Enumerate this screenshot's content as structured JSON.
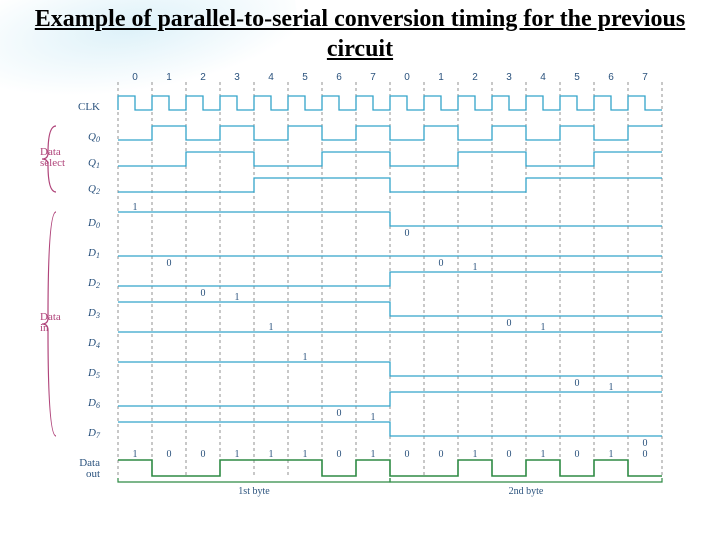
{
  "title": "Example of parallel-to-serial conversion timing for the previous circuit",
  "clk_label": "CLK",
  "ticks": [
    "0",
    "1",
    "2",
    "3",
    "4",
    "5",
    "6",
    "7",
    "0",
    "1",
    "2",
    "3",
    "4",
    "5",
    "6",
    "7"
  ],
  "data_select_label": "Data\nselect",
  "data_in_label": "Data\nin",
  "data_out_label": "Data\nout",
  "byte1_label": "1st byte",
  "byte2_label": "2nd byte",
  "chart_data": {
    "type": "timing-diagram",
    "clock_cycles": 16,
    "signals": [
      {
        "name": "CLK",
        "kind": "clock",
        "period": 1,
        "label": "CLK"
      },
      {
        "name": "Q0",
        "kind": "counter-bit",
        "period": 2,
        "label": "Q",
        "sub": "0"
      },
      {
        "name": "Q1",
        "kind": "counter-bit",
        "period": 4,
        "label": "Q",
        "sub": "1"
      },
      {
        "name": "Q2",
        "kind": "counter-bit",
        "period": 8,
        "label": "Q",
        "sub": "2"
      },
      {
        "name": "D0",
        "kind": "data-in",
        "byte1": "1",
        "byte2": "0",
        "label": "D",
        "sub": "0"
      },
      {
        "name": "D1",
        "kind": "data-in",
        "byte1": "0",
        "byte2": "0",
        "label": "D",
        "sub": "1"
      },
      {
        "name": "D2",
        "kind": "data-in",
        "byte1": "0",
        "byte2": "1",
        "label": "D",
        "sub": "2"
      },
      {
        "name": "D3",
        "kind": "data-in",
        "byte1": "1",
        "byte2": "0",
        "label": "D",
        "sub": "3"
      },
      {
        "name": "D4",
        "kind": "data-in",
        "byte1": "1",
        "byte2": "1",
        "label": "D",
        "sub": "4"
      },
      {
        "name": "D5",
        "kind": "data-in",
        "byte1": "1",
        "byte2": "0",
        "label": "D",
        "sub": "5"
      },
      {
        "name": "D6",
        "kind": "data-in",
        "byte1": "0",
        "byte2": "1",
        "label": "D",
        "sub": "6"
      },
      {
        "name": "D7",
        "kind": "data-in",
        "byte1": "1",
        "byte2": "0",
        "label": "D",
        "sub": "7"
      }
    ],
    "data_out": {
      "name": "Data out",
      "bits_byte1": [
        "1",
        "0",
        "0",
        "1",
        "1",
        "1",
        "0",
        "1"
      ],
      "bits_byte2": [
        "0",
        "0",
        "1",
        "0",
        "1",
        "0",
        "1",
        "0"
      ]
    }
  }
}
